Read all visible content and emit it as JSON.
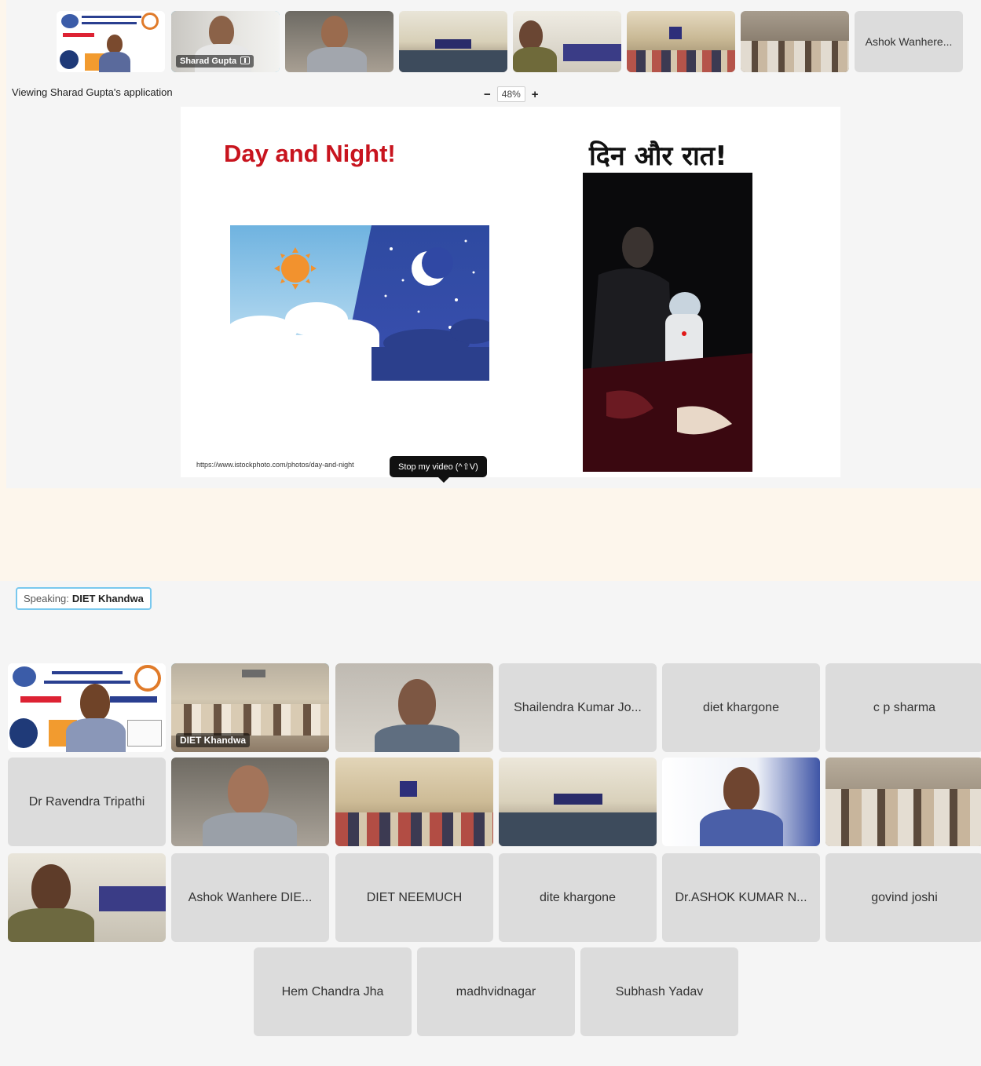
{
  "filmstrip": {
    "tiles": [
      {
        "type": "video",
        "label": ""
      },
      {
        "type": "video",
        "label": "Sharad Gupta"
      },
      {
        "type": "video",
        "label": ""
      },
      {
        "type": "video",
        "label": ""
      },
      {
        "type": "video",
        "label": ""
      },
      {
        "type": "video",
        "label": ""
      },
      {
        "type": "video",
        "label": ""
      },
      {
        "type": "name",
        "label": "Ashok Wanhere..."
      }
    ]
  },
  "share": {
    "viewing_label": "Viewing Sharad Gupta's application",
    "zoom_minus": "−",
    "zoom_value": "48%",
    "zoom_plus": "+"
  },
  "slide": {
    "title_en": "Day and Night!",
    "title_hi": "दिन और रात!",
    "url": "https://www.istockphoto.com/photos/day-and-night"
  },
  "tooltip": "Stop my video (^⇧V)",
  "speaking": {
    "prefix": "Speaking:",
    "name": "DIET Khandwa"
  },
  "gallery": {
    "row1": [
      {
        "type": "video",
        "label": ""
      },
      {
        "type": "video",
        "label": "DIET Khandwa"
      },
      {
        "type": "video",
        "label": ""
      },
      {
        "type": "name",
        "label": "Shailendra Kumar Jo..."
      },
      {
        "type": "name",
        "label": "diet khargone"
      },
      {
        "type": "name",
        "label": "c p sharma"
      }
    ],
    "row2": [
      {
        "type": "name",
        "label": "Dr Ravendra Tripathi"
      },
      {
        "type": "video",
        "label": ""
      },
      {
        "type": "video",
        "label": ""
      },
      {
        "type": "video",
        "label": ""
      },
      {
        "type": "video",
        "label": ""
      },
      {
        "type": "video",
        "label": ""
      }
    ],
    "row3": [
      {
        "type": "video",
        "label": ""
      },
      {
        "type": "name",
        "label": "Ashok Wanhere DIE..."
      },
      {
        "type": "name",
        "label": "DIET NEEMUCH"
      },
      {
        "type": "name",
        "label": "dite khargone"
      },
      {
        "type": "name",
        "label": "Dr.ASHOK KUMAR N..."
      },
      {
        "type": "name",
        "label": "govind joshi"
      }
    ],
    "row4": [
      {
        "type": "name",
        "label": "Hem Chandra Jha"
      },
      {
        "type": "name",
        "label": "madhvidnagar"
      },
      {
        "type": "name",
        "label": "Subhash Yadav"
      }
    ]
  },
  "colors": {
    "active_border": "#35b9ec",
    "title_red": "#c8141e",
    "tile_gray": "#dcdcdc"
  }
}
